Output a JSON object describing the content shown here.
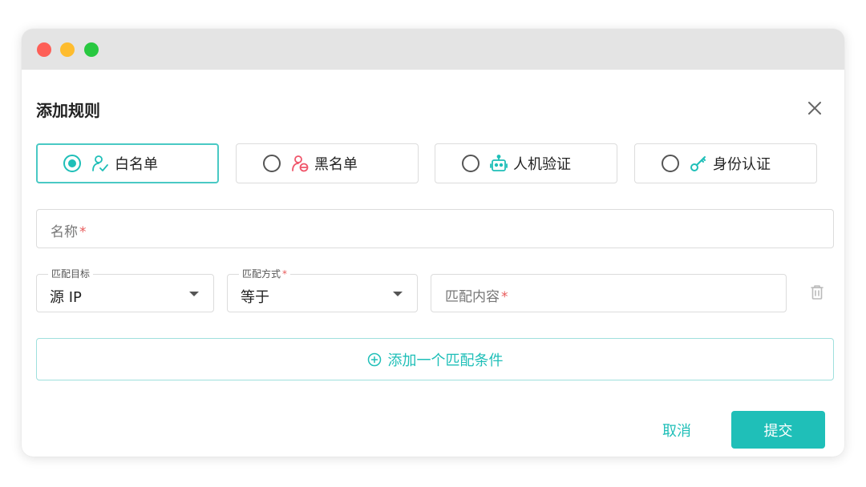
{
  "dialog": {
    "title": "添加规则"
  },
  "rule_types": [
    {
      "label": "白名单",
      "icon": "user-check-icon",
      "selected": true
    },
    {
      "label": "黑名单",
      "icon": "user-block-icon",
      "selected": false
    },
    {
      "label": "人机验证",
      "icon": "robot-icon",
      "selected": false
    },
    {
      "label": "身份认证",
      "icon": "key-icon",
      "selected": false
    }
  ],
  "name_field": {
    "placeholder": "名称",
    "required_mark": "*",
    "value": ""
  },
  "condition": {
    "target_label": "匹配目标",
    "target_value": "源 IP",
    "method_label": "匹配方式",
    "method_required_mark": "*",
    "method_value": "等于",
    "content_placeholder": "匹配内容",
    "content_required_mark": "*"
  },
  "add_condition_label": "添加一个匹配条件",
  "footer": {
    "cancel_label": "取消",
    "submit_label": "提交"
  },
  "colors": {
    "accent": "#1fbfb8",
    "accent_border": "#49c9c4",
    "required": "#e85a5a",
    "blacklist_icon": "#f0556a"
  }
}
